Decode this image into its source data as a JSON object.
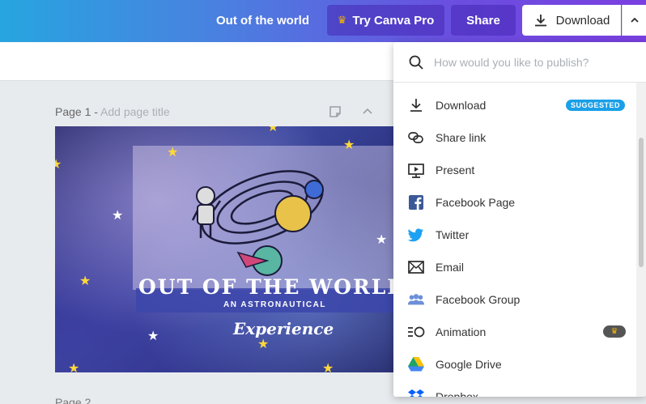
{
  "header": {
    "doc_title": "Out of the world",
    "pro_label": "Try Canva Pro",
    "share_label": "Share",
    "download_label": "Download",
    "brand_color": "#7d2ae8",
    "download_icon": "download-icon",
    "chevron_icon": "chevron-up-icon",
    "crown_icon": "crown-icon"
  },
  "page": {
    "page_label": "Page 1 - ",
    "add_title": "Add page title",
    "page2_label": "Page 2",
    "tools": [
      "notes-icon",
      "chevron-up-icon"
    ]
  },
  "design": {
    "headline": "OUT OF THE WORLD",
    "subline": "AN ASTRONAUTICAL",
    "script": "Experience"
  },
  "publish": {
    "search_placeholder": "How would you like to publish?",
    "suggested_badge": "SUGGESTED",
    "items": [
      {
        "label": "Download",
        "icon": "download-icon"
      },
      {
        "label": "Share link",
        "icon": "link-icon"
      },
      {
        "label": "Present",
        "icon": "present-icon"
      },
      {
        "label": "Facebook Page",
        "icon": "facebook-icon"
      },
      {
        "label": "Twitter",
        "icon": "twitter-icon"
      },
      {
        "label": "Email",
        "icon": "email-icon"
      },
      {
        "label": "Facebook Group",
        "icon": "facebook-group-icon"
      },
      {
        "label": "Animation",
        "icon": "animation-icon"
      },
      {
        "label": "Google Drive",
        "icon": "google-drive-icon"
      },
      {
        "label": "Dropbox",
        "icon": "dropbox-icon"
      }
    ]
  }
}
